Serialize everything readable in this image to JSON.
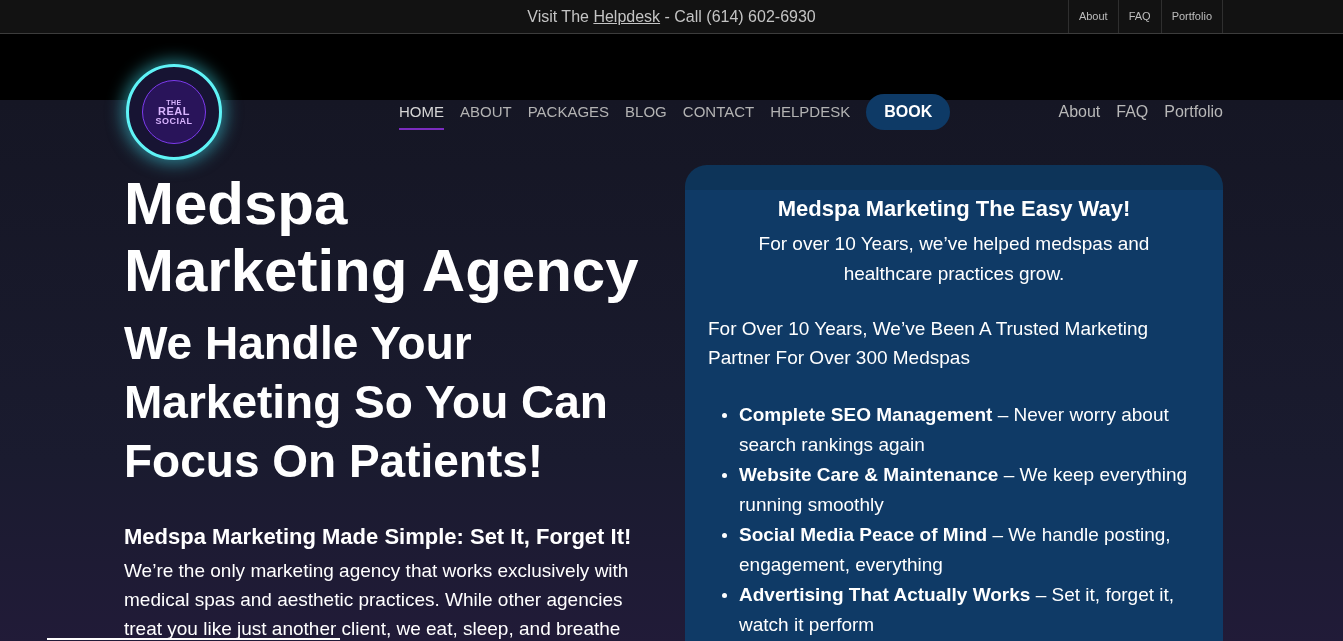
{
  "top_bar": {
    "lead": "Visit The",
    "link": "Helpdesk",
    "tail": "- Call (614) 602-6930",
    "links": [
      "About",
      "FAQ",
      "Portfolio"
    ]
  },
  "header": {
    "logo": {
      "lines": [
        "THE",
        "REAL",
        "SOCIAL"
      ]
    },
    "nav": [
      {
        "label": "HOME",
        "selected": true
      },
      {
        "label": "ABOUT",
        "selected": false
      },
      {
        "label": "PACKAGES",
        "selected": false
      },
      {
        "label": "BLOG",
        "selected": false
      },
      {
        "label": "CONTACT",
        "selected": false
      },
      {
        "label": "HELPDESK",
        "selected": false
      }
    ],
    "book_button": "BOOK",
    "secondary_nav": [
      "About",
      "FAQ",
      "Portfolio"
    ]
  },
  "hero": {
    "title": "Medspa Marketing Agency",
    "subtitle": "We Handle Your Marketing So You Can Focus On Patients!",
    "heading": "Medspa Marketing Made Simple: Set It, Forget It!",
    "paragraph": "We’re the only marketing agency that works exclusively with medical spas and aesthetic practices. While other agencies treat you like just another client, we eat, sleep, and breathe"
  },
  "card": {
    "title": "Medspa Marketing The Easy Way!",
    "intro": "For over 10 Years, we’ve helped medspas and healthcare practices grow.",
    "paragraph": "For Over 10 Years, We’ve Been A Trusted Marketing Partner For Over 300 Medspas",
    "items": [
      "**Complete SEO Management** – Never worry about search rankings again",
      "**Website Care & Maintenance** – We keep everything running smoothly",
      "**Social Media Peace of Mind** – We handle posting, engagement, everything",
      "**Advertising That Actually Works** – Set it, forget it, watch it perform"
    ]
  }
}
